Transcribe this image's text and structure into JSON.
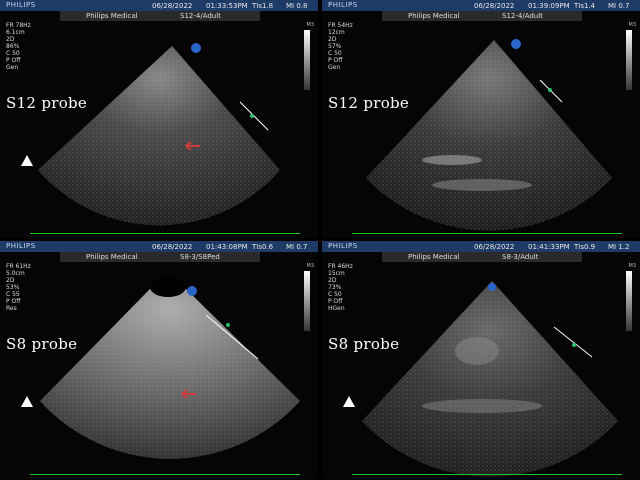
{
  "panels": [
    {
      "logo": "PHILIPS",
      "date": "06/28/2022",
      "time": "01:33:53PM",
      "ti": "TIs1.8",
      "mi": "MI 0.8",
      "institution": "Philips Medical",
      "preset": "S12-4/Adult",
      "params": [
        "FR 78Hz",
        "6.1cm",
        "2D",
        "86%",
        "C 50",
        "P Off",
        "Gen"
      ],
      "label": "S12 probe",
      "has_arrow": true,
      "orient": [
        "G",
        "P",
        "R"
      ]
    },
    {
      "logo": "PHILIPS",
      "date": "06/28/2022",
      "time": "01:39:09PM",
      "ti": "TIs1.4",
      "mi": "MI 0.7",
      "institution": "Philips Medical",
      "preset": "S12-4/Adult",
      "params": [
        "FR 54Hz",
        "12cm",
        "2D",
        "57%",
        "C 50",
        "P Off",
        "Gen"
      ],
      "label": "S12 probe",
      "has_arrow": false,
      "orient": [
        "G",
        "P",
        "R"
      ]
    },
    {
      "logo": "PHILIPS",
      "date": "06/28/2022",
      "time": "01:43:08PM",
      "ti": "TIs0.6",
      "mi": "MI 0.7",
      "institution": "Philips Medical",
      "preset": "S8-3/S8Ped",
      "params": [
        "FR 61Hz",
        "5.0cm",
        "2D",
        "53%",
        "C 55",
        "P Off",
        "Res"
      ],
      "label": "S8 probe",
      "has_arrow": true,
      "orient": [
        "G",
        "P",
        "R"
      ]
    },
    {
      "logo": "PHILIPS",
      "date": "06/28/2022",
      "time": "01:41:33PM",
      "ti": "TIs0.9",
      "mi": "MI 1.2",
      "institution": "Philips Medical",
      "preset": "S8-3/Adult",
      "params": [
        "FR 46Hz",
        "15cm",
        "2D",
        "73%",
        "C 50",
        "P Off",
        "HGen"
      ],
      "label": "S8 probe",
      "has_arrow": false,
      "orient": [
        "G",
        "P",
        "R"
      ]
    }
  ],
  "grayscale_label": "M3",
  "colors": {
    "bar": "#1e3a66",
    "baseline": "#1ec21e",
    "marker": "#26c26e",
    "arrow": "#d23a3a"
  }
}
